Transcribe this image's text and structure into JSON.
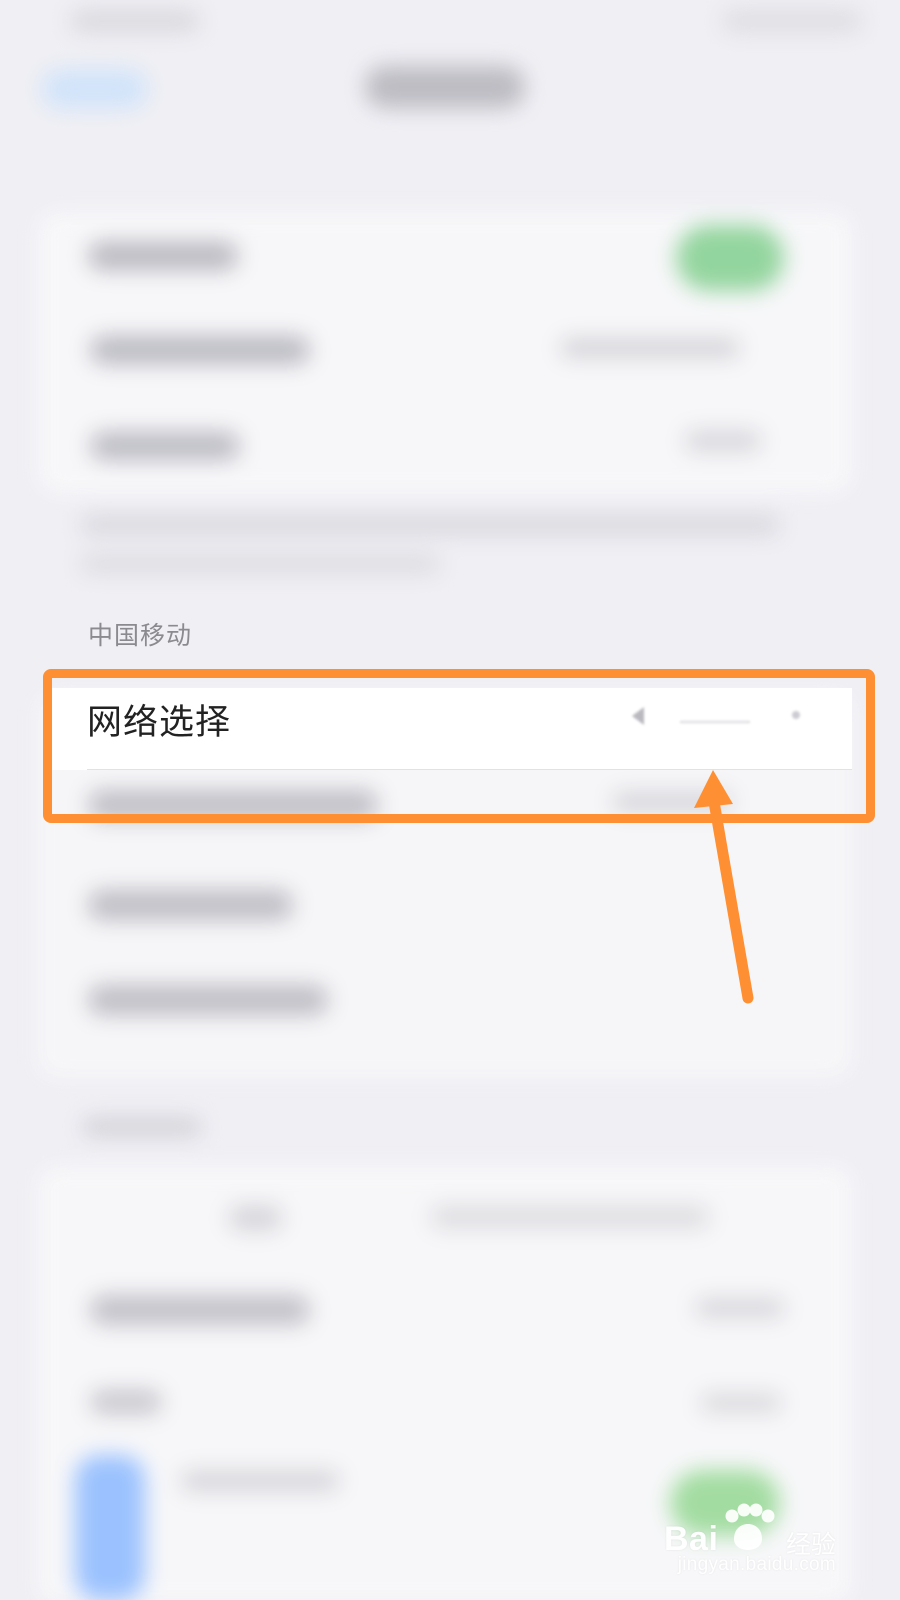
{
  "section": {
    "carrier_label": "中国移动"
  },
  "selected_row": {
    "label": "网络选择"
  },
  "highlight": {
    "color": "#ff8f33"
  },
  "watermark": {
    "brand": "Bai",
    "brand_cn": "经验",
    "site": "jingyan.baidu.com",
    "paw_icon": "paw-icon"
  },
  "icons": {
    "left_chevron": "chevron-left-icon",
    "right_dot": "dot-icon",
    "arrow": "arrow-icon"
  }
}
